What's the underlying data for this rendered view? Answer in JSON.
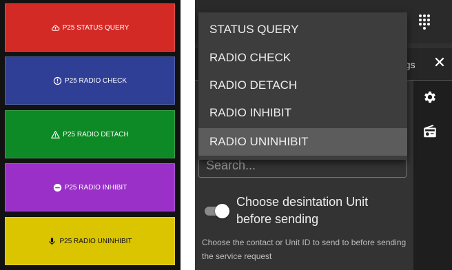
{
  "colors": {
    "status_query": "#d42a26",
    "radio_check": "#303f96",
    "radio_detach": "#0d8a25",
    "radio_inhibit": "#9a30c8",
    "radio_uninhibit": "#dbc400"
  },
  "left_buttons": [
    {
      "label": "P25 STATUS QUERY",
      "icon": "cloud-icon"
    },
    {
      "label": "P25 RADIO CHECK",
      "icon": "alert-circle-icon"
    },
    {
      "label": "P25 RADIO DETACH",
      "icon": "warning-triangle-icon"
    },
    {
      "label": "P25 RADIO INHIBIT",
      "icon": "minus-circle-icon"
    },
    {
      "label": "P25 RADIO UNINHIBIT",
      "icon": "microphone-icon"
    }
  ],
  "header": {
    "tab_fragment": "ngs",
    "close_icon": "close-icon",
    "dialpad_icon": "dialpad-icon"
  },
  "sidebar": {
    "settings_icon": "gear-icon",
    "radio_icon": "radio-icon"
  },
  "dropdown": {
    "options": [
      "STATUS QUERY",
      "RADIO CHECK",
      "RADIO DETACH",
      "RADIO INHIBIT",
      "RADIO UNINHIBIT"
    ],
    "highlighted": "RADIO UNINHIBIT"
  },
  "search": {
    "placeholder": "Search..."
  },
  "option": {
    "label": "Choose desintation Unit before sending",
    "enabled": true,
    "helper": "Choose the contact or Unit ID to send to before sending the service request"
  }
}
